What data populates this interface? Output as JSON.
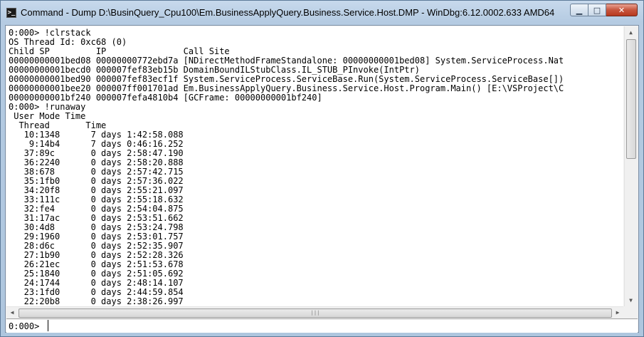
{
  "window": {
    "title": "Command - Dump D:\\BusinQuery_Cpu100\\Em.BusinessApplyQuery.Business.Service.Host.DMP - WinDbg:6.12.0002.633 AMD64",
    "icon": "console-icon",
    "minimize_label": "▁",
    "maximize_label": "□",
    "close_label": "✕"
  },
  "output": {
    "lines": [
      "0:000> !clrstack",
      "OS Thread Id: 0xc68 (0)",
      "Child SP         IP               Call Site",
      "00000000001bed08 00000000772ebd7a [NDirectMethodFrameStandalone: 00000000001bed08] System.ServiceProcess.Nat",
      "00000000001becd0 000007fef83eb15b DomainBoundILStubClass.IL_STUB_PInvoke(IntPtr)",
      "00000000001bed90 000007fef83ecf1f System.ServiceProcess.ServiceBase.Run(System.ServiceProcess.ServiceBase[])",
      "00000000001bee20 000007ff001701ad Em.BusinessApplyQuery.Business.Service.Host.Program.Main() [E:\\VSProject\\C",
      "00000000001bf240 000007fefa4810b4 [GCFrame: 00000000001bf240]",
      "0:000> !runaway",
      " User Mode Time",
      "  Thread       Time",
      "   10:1348      7 days 1:42:58.088",
      "    9:14b4      7 days 0:46:16.252",
      "   37:89c       0 days 2:58:47.190",
      "   36:2240      0 days 2:58:20.888",
      "   38:678       0 days 2:57:42.715",
      "   35:1fb0      0 days 2:57:36.022",
      "   34:20f8      0 days 2:55:21.097",
      "   33:111c      0 days 2:55:18.632",
      "   32:fe4       0 days 2:54:04.875",
      "   31:17ac      0 days 2:53:51.662",
      "   30:4d8       0 days 2:53:24.798",
      "   29:1960      0 days 2:53:01.757",
      "   28:d6c       0 days 2:52:35.907",
      "   27:1b90      0 days 2:52:28.326",
      "   26:21ec      0 days 2:51:53.678",
      "   25:1840      0 days 2:51:05.692",
      "   24:1744      0 days 2:48:14.107",
      "   23:1fd0      0 days 2:44:59.854",
      "   22:20b8      0 days 2:38:26.997"
    ]
  },
  "scrollbars": {
    "up_arrow": "▲",
    "down_arrow": "▼",
    "left_arrow": "◀",
    "right_arrow": "▶",
    "grip": "|||"
  },
  "command": {
    "prompt": "0:000>",
    "value": ""
  }
}
